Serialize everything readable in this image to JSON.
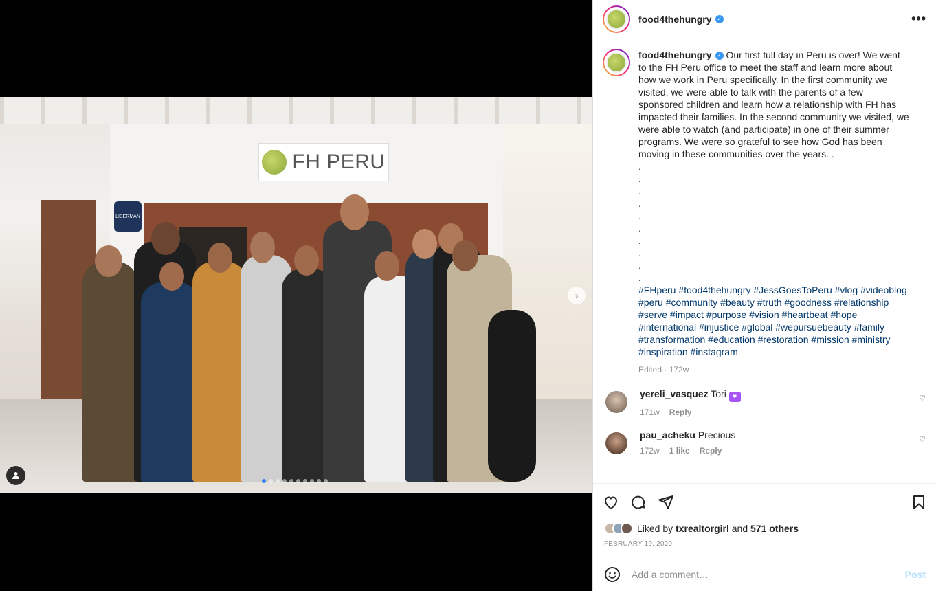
{
  "post": {
    "username": "food4thehungry",
    "verified_mark": "✓",
    "more_icon": "more-horizontal-icon",
    "image_sign_text": "FH PERU",
    "image_badge_text": "LIBERMAN",
    "carousel": {
      "total": 10,
      "active": 0
    }
  },
  "caption": {
    "username": "food4thehungry",
    "text": "Our first full day in Peru is over! We went to the FH Peru office to meet the staff and learn more about how we work in Peru specifically. In the first community we visited, we were able to talk with the parents of a few sponsored children and learn how a relationship with FH has impacted their families. In the second community we visited, we were able to watch (and participate) in one of their summer programs. We were so grateful to see how God has been moving in these communities over the years. .",
    "dots": [
      ".",
      ".",
      ".",
      ".",
      ".",
      ".",
      ".",
      ".",
      ".",
      "."
    ],
    "hashtags": [
      "#FHperu",
      "#food4thehungry",
      "#JessGoesToPeru",
      "#vlog",
      "#videoblog",
      "#peru",
      "#community",
      "#beauty",
      "#truth",
      "#goodness",
      "#relationship",
      "#serve",
      "#impact",
      "#purpose",
      "#vision",
      "#heartbeat",
      "#hope",
      "#international",
      "#injustice",
      "#global",
      "#wepursuebeauty",
      "#family",
      "#transformation",
      "#education",
      "#restoration",
      "#mission",
      "#ministry",
      "#inspiration",
      "#instagram"
    ],
    "edited": "Edited · 172w"
  },
  "comments": [
    {
      "username": "yereli_vasquez",
      "text": "Tori",
      "emoji": "💜",
      "time": "171w",
      "likes": "",
      "reply": "Reply"
    },
    {
      "username": "pau_acheku",
      "text": "Precious",
      "emoji": "",
      "time": "172w",
      "likes": "1 like",
      "reply": "Reply"
    }
  ],
  "likes": {
    "prefix": "Liked by",
    "user": "txrealtorgirl",
    "and": "and",
    "others": "571 others"
  },
  "date": "FEBRUARY 19, 2020",
  "add_comment": {
    "placeholder": "Add a comment…",
    "post_label": "Post"
  },
  "colors": {
    "link": "#00376b",
    "post_button": "#b2dffc",
    "verified": "#3897f0",
    "carousel_active": "#3b82f6"
  }
}
